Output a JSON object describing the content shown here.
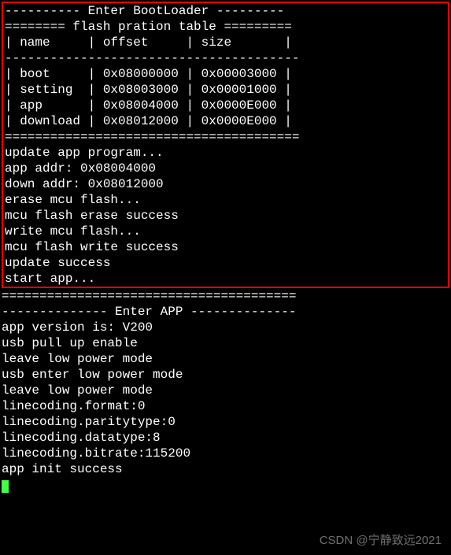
{
  "boot": {
    "header_dashes": "---------- Enter BootLoader ---------",
    "blank": "",
    "table_title": "======== flash pration table =========",
    "table_header": "| name     | offset     | size       |",
    "table_sep": "---------------------------------------",
    "rows": [
      "| boot     | 0x08000000 | 0x00003000 |",
      "| setting  | 0x08003000 | 0x00001000 |",
      "| app      | 0x08004000 | 0x0000E000 |",
      "| download | 0x08012000 | 0x0000E000 |"
    ],
    "table_end": "=======================================",
    "log": [
      "update app program...",
      "app addr: 0x08004000",
      "down addr: 0x08012000",
      "erase mcu flash...",
      "mcu flash erase success",
      "write mcu flash...",
      "mcu flash write success",
      "update success",
      "start app..."
    ]
  },
  "app": {
    "sep": "=======================================",
    "header": "-------------- Enter APP --------------",
    "version": "app version is: V200",
    "blank": "",
    "log": [
      "usb pull up enable",
      "leave low power mode",
      "usb enter low power mode",
      "leave low power mode",
      "linecoding.format:0",
      "linecoding.paritytype:0",
      "linecoding.datatype:8",
      "linecoding.bitrate:115200",
      "app init success"
    ]
  },
  "watermark": "CSDN @宁静致远2021"
}
